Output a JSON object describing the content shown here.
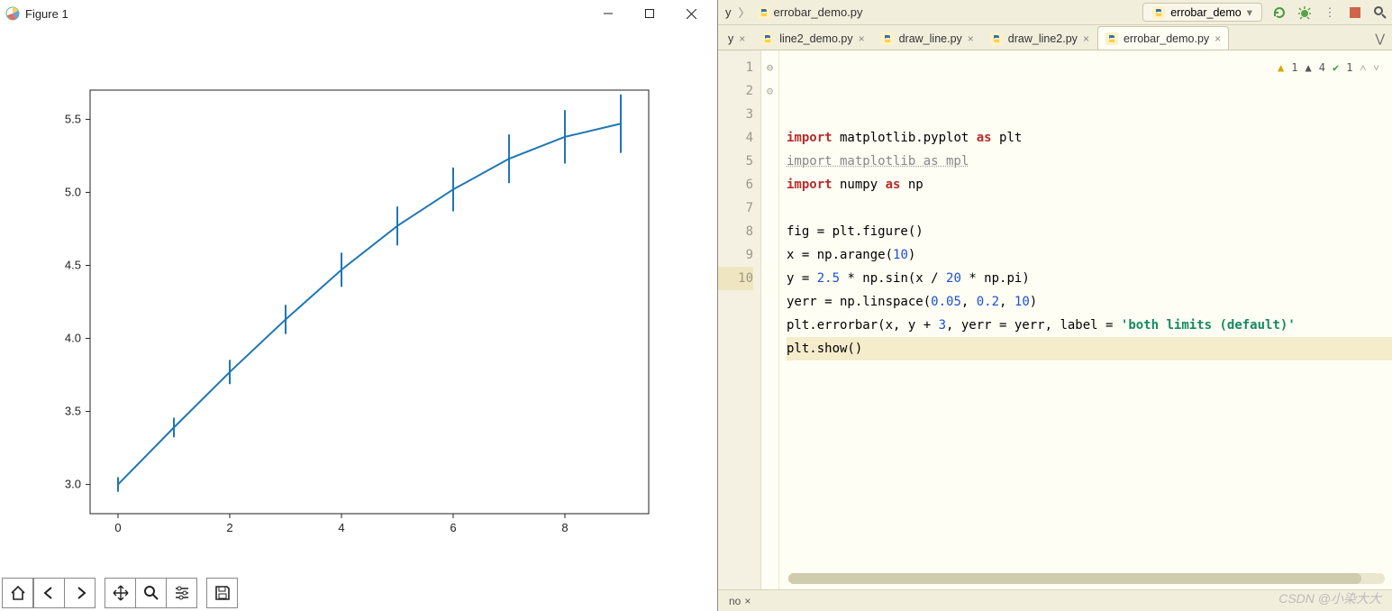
{
  "figure_window": {
    "title": "Figure 1",
    "toolbar": {
      "home": "Home",
      "back": "Back",
      "forward": "Forward",
      "pan": "Pan",
      "zoom": "Zoom",
      "configure": "Configure subplots",
      "save": "Save"
    }
  },
  "chart_data": {
    "type": "line",
    "x": [
      0,
      1,
      2,
      3,
      4,
      5,
      6,
      7,
      8,
      9
    ],
    "y": [
      3.0,
      3.39,
      3.77,
      4.13,
      4.47,
      4.77,
      5.02,
      5.23,
      5.38,
      5.47
    ],
    "yerr": [
      0.05,
      0.067,
      0.083,
      0.1,
      0.117,
      0.133,
      0.15,
      0.167,
      0.183,
      0.2
    ],
    "title": "",
    "xlabel": "",
    "ylabel": "",
    "xlim": [
      -0.5,
      9.5
    ],
    "ylim": [
      2.8,
      5.7
    ],
    "xticks": [
      0,
      2,
      4,
      6,
      8
    ],
    "yticks": [
      3.0,
      3.5,
      4.0,
      4.5,
      5.0,
      5.5
    ],
    "label": "both limits (default)"
  },
  "ide": {
    "breadcrumb": {
      "tail": "errobar_demo.py",
      "prefix_suffix": "y"
    },
    "run_config": "errobar_demo",
    "tabs": [
      {
        "label": "y",
        "active": false,
        "truncated": true
      },
      {
        "label": "line2_demo.py",
        "active": false
      },
      {
        "label": "draw_line.py",
        "active": false
      },
      {
        "label": "draw_line2.py",
        "active": false
      },
      {
        "label": "errobar_demo.py",
        "active": true
      }
    ],
    "bottom_tab": "no",
    "watermark": "CSDN @小染大大",
    "inspection": {
      "warn_count": "1",
      "weak_count": "4",
      "ok_count": "1"
    },
    "code_lines": [
      {
        "n": 1,
        "fold": "⊖",
        "raw": "import matplotlib.pyplot as plt"
      },
      {
        "n": 2,
        "fold": "",
        "raw": "import matplotlib as mpl",
        "dim": true
      },
      {
        "n": 3,
        "fold": "⊝",
        "raw": "import numpy as np"
      },
      {
        "n": 4,
        "fold": "",
        "raw": ""
      },
      {
        "n": 5,
        "fold": "",
        "raw": "fig = plt.figure()"
      },
      {
        "n": 6,
        "fold": "",
        "raw": "x = np.arange(10)"
      },
      {
        "n": 7,
        "fold": "",
        "raw": "y = 2.5 * np.sin(x / 20 * np.pi)"
      },
      {
        "n": 8,
        "fold": "",
        "raw": "yerr = np.linspace(0.05, 0.2, 10)"
      },
      {
        "n": 9,
        "fold": "",
        "raw": "plt.errorbar(x, y + 3, yerr = yerr, label = 'both limits (default)'"
      },
      {
        "n": 10,
        "fold": "",
        "raw": "plt.show()",
        "current": true
      }
    ]
  }
}
